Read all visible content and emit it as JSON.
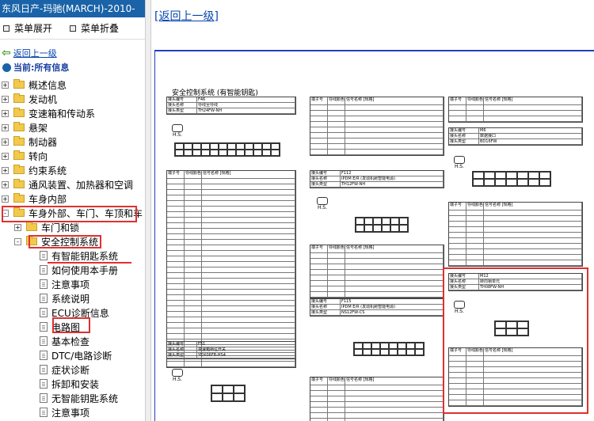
{
  "sidebar": {
    "window_title": "东风日产-玛驰(MARCH)-2010-",
    "menu": {
      "expand_label": "菜单展开",
      "collapse_label": "菜单折叠"
    },
    "back_label": "返回上一级",
    "current_label": "当前:所有信息",
    "tree": [
      {
        "label": "概述信息",
        "level": 0,
        "type": "folder",
        "expander": "+"
      },
      {
        "label": "发动机",
        "level": 0,
        "type": "folder",
        "expander": "+"
      },
      {
        "label": "变速箱和传动系",
        "level": 0,
        "type": "folder",
        "expander": "+"
      },
      {
        "label": "悬架",
        "level": 0,
        "type": "folder",
        "expander": "+"
      },
      {
        "label": "制动器",
        "level": 0,
        "type": "folder",
        "expander": "+"
      },
      {
        "label": "转向",
        "level": 0,
        "type": "folder",
        "expander": "+"
      },
      {
        "label": "约束系统",
        "level": 0,
        "type": "folder",
        "expander": "+"
      },
      {
        "label": "通风装置、加热器和空调",
        "level": 0,
        "type": "folder",
        "expander": "+"
      },
      {
        "label": "车身内部",
        "level": 0,
        "type": "folder",
        "expander": "+"
      },
      {
        "label": "车身外部、车门、车顶和车",
        "level": 0,
        "type": "folder",
        "expander": "-"
      },
      {
        "label": "车门和锁",
        "level": 1,
        "type": "folder",
        "expander": "+"
      },
      {
        "label": "安全控制系统",
        "level": 1,
        "type": "folder",
        "expander": "-"
      },
      {
        "label": "有智能钥匙系统",
        "level": 2,
        "type": "doc"
      },
      {
        "label": "如何使用本手册",
        "level": 2,
        "type": "doc"
      },
      {
        "label": "注意事项",
        "level": 2,
        "type": "doc"
      },
      {
        "label": "系统说明",
        "level": 2,
        "type": "doc"
      },
      {
        "label": "ECU诊断信息",
        "level": 2,
        "type": "doc"
      },
      {
        "label": "电路图",
        "level": 2,
        "type": "doc"
      },
      {
        "label": "基本检查",
        "level": 2,
        "type": "doc"
      },
      {
        "label": "DTC/电路诊断",
        "level": 2,
        "type": "doc"
      },
      {
        "label": "症状诊断",
        "level": 2,
        "type": "doc"
      },
      {
        "label": "拆卸和安装",
        "level": 2,
        "type": "doc"
      },
      {
        "label": "无智能钥匙系统",
        "level": 2,
        "type": "doc"
      },
      {
        "label": "注意事项",
        "level": 2,
        "type": "doc"
      }
    ]
  },
  "content": {
    "back_link": "[返回上一级]",
    "doc_title": "安全控制系统 (有智能钥匙)",
    "connectors": [
      {
        "id": "F46",
        "name": "导线至导线",
        "type": "TH24FW-NH"
      },
      {
        "id": "F112",
        "name": "IPDM E/R (发动机舱智能电源)",
        "type": "TH12FW-NH"
      },
      {
        "id": "F115",
        "name": "IPDM E/R (发动机舱智能电源)",
        "type": "NS12FW-CS"
      },
      {
        "id": "F51",
        "name": "变速箱档位开关",
        "type": "YDX06FB-HS4"
      },
      {
        "id": "M6",
        "name": "数据接口",
        "type": "BD16FW"
      },
      {
        "id": "M12",
        "name": "转向锁单元",
        "type": "TH08FW-NH"
      }
    ],
    "hs_label": "H.S.",
    "pin_header": [
      "端子号",
      "导线颜色",
      "信号名称 [规格]"
    ]
  },
  "colors": {
    "title_bg": "#1a63a8",
    "highlight": "#e03030",
    "frame": "#2040c0",
    "link": "#0645ad"
  }
}
